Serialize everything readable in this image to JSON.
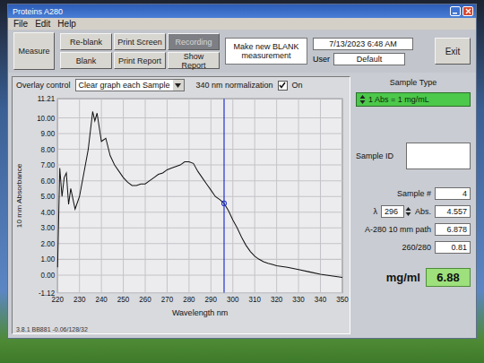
{
  "window": {
    "title": "Proteins A280"
  },
  "menu": [
    "File",
    "Edit",
    "Help"
  ],
  "toolbar": {
    "measure": "Measure",
    "buttons": [
      {
        "label": "Re-blank",
        "disabled": false
      },
      {
        "label": "Print Screen",
        "disabled": false
      },
      {
        "label": "Recording",
        "disabled": true
      },
      {
        "label": "Blank",
        "disabled": false
      },
      {
        "label": "Print Report",
        "disabled": false
      },
      {
        "label": "Show Report",
        "disabled": false
      }
    ],
    "message": "Make new BLANK measurement",
    "datetime": "7/13/2023 6:48 AM",
    "user_label": "User",
    "user": "Default",
    "exit": "Exit"
  },
  "overlay": {
    "label": "Overlay control",
    "value": "Clear graph each Sample"
  },
  "normalization": {
    "label": "340 nm normalization",
    "checked": true,
    "state": "On"
  },
  "chart": {
    "y_title": "10 mm Absorbance",
    "x_title": "Wavelength nm",
    "y_ticks": [
      "11.21",
      "10.00",
      "9.00",
      "8.00",
      "7.00",
      "6.00",
      "5.00",
      "4.00",
      "3.00",
      "2.00",
      "1.00",
      "0.00",
      "-1.12"
    ],
    "x_ticks": [
      "220",
      "230",
      "240",
      "250",
      "260",
      "270",
      "280",
      "290",
      "300",
      "310",
      "320",
      "330",
      "340",
      "350"
    ],
    "cursor": 296,
    "series": [
      {
        "wavelength": [
          220,
          221,
          222,
          223,
          224,
          225,
          226,
          228,
          230,
          232,
          234,
          236,
          237,
          238,
          240,
          242,
          244,
          246,
          248,
          250,
          252,
          254,
          256,
          258,
          260,
          262,
          264,
          266,
          268,
          270,
          272,
          274,
          276,
          278,
          280,
          282,
          284,
          286,
          288,
          290,
          292,
          294,
          296,
          298,
          300,
          302,
          304,
          306,
          308,
          310,
          312,
          314,
          316,
          318,
          320,
          325,
          330,
          335,
          340,
          345,
          350
        ],
        "absorbance": [
          0.5,
          6.8,
          5.0,
          6.2,
          6.5,
          4.5,
          5.5,
          4.2,
          5.0,
          6.5,
          8.0,
          10.4,
          9.8,
          10.3,
          8.5,
          8.7,
          7.6,
          7.0,
          6.6,
          6.2,
          5.9,
          5.7,
          5.7,
          5.8,
          5.8,
          6.0,
          6.2,
          6.4,
          6.5,
          6.7,
          6.8,
          6.9,
          7.0,
          7.2,
          7.2,
          7.1,
          6.6,
          6.2,
          5.8,
          5.4,
          5.0,
          4.8,
          4.56,
          4.1,
          3.5,
          3.0,
          2.4,
          1.9,
          1.5,
          1.2,
          1.0,
          0.85,
          0.75,
          0.68,
          0.6,
          0.5,
          0.35,
          0.2,
          0.05,
          -0.05,
          -0.15
        ]
      }
    ]
  },
  "sample_type": {
    "label": "Sample Type",
    "value": "1 Abs = 1 mg/mL"
  },
  "sample_id": {
    "label": "Sample ID",
    "value": ""
  },
  "sample_number": {
    "label": "Sample #",
    "value": "4"
  },
  "lambda": {
    "label": "λ",
    "value": "296"
  },
  "abs": {
    "label": "Abs.",
    "value": "4.557"
  },
  "a280": {
    "label": "A-280 10 mm path",
    "value": "6.878"
  },
  "ratio": {
    "label": "260/280",
    "value": "0.81"
  },
  "concentration": {
    "label": "mg/ml",
    "value": "6.88"
  },
  "status_bar": "3.8.1 BB881 -0.06/128/32"
}
